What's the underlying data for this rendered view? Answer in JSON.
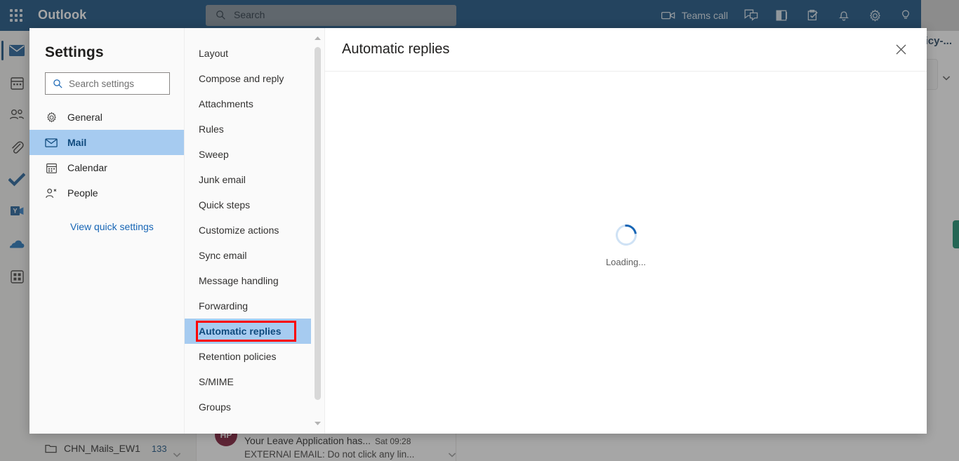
{
  "topbar": {
    "brand": "Outlook",
    "waffle_icon": "app-launcher-icon",
    "search": {
      "placeholder": "Search",
      "icon": "search-icon"
    },
    "teams_call_label": "Teams call",
    "icons": [
      {
        "name": "video-camera-icon"
      },
      {
        "name": "chat-icon"
      },
      {
        "name": "office-app-icon"
      },
      {
        "name": "tasks-icon"
      },
      {
        "name": "notifications-bell-icon"
      },
      {
        "name": "settings-gear-icon"
      },
      {
        "name": "lightbulb-idea-icon"
      }
    ]
  },
  "rail": {
    "items": [
      {
        "name": "mail-icon",
        "label": "Mail",
        "selected": true
      },
      {
        "name": "calendar-icon",
        "label": "Calendar",
        "selected": false
      },
      {
        "name": "people-icon",
        "label": "People",
        "selected": false
      },
      {
        "name": "attachments-paperclip-icon",
        "label": "Files",
        "selected": false
      },
      {
        "name": "todo-check-icon",
        "label": "To Do",
        "selected": false
      },
      {
        "name": "yammer-icon",
        "label": "Yammer",
        "selected": false
      },
      {
        "name": "onedrive-cloud-icon",
        "label": "OneDrive",
        "selected": false
      },
      {
        "name": "all-apps-grid-icon",
        "label": "All apps",
        "selected": false
      }
    ]
  },
  "background": {
    "folder": {
      "name": "CHN_Mails_EW1",
      "count": "133"
    },
    "mail": {
      "avatar_initials": "HP",
      "subject": "Your Leave Application has...",
      "time": "Sat 09:28",
      "preview": "EXTERNAl EMAIL: Do not click any lin..."
    },
    "reading_subject": "licy-...",
    "green_accent_color": "#11896a"
  },
  "settings": {
    "title": "Settings",
    "search": {
      "placeholder": "Search settings",
      "icon": "search-icon"
    },
    "nav": [
      {
        "label": "General",
        "icon": "gear-icon",
        "active": false
      },
      {
        "label": "Mail",
        "icon": "envelope-icon",
        "active": true
      },
      {
        "label": "Calendar",
        "icon": "calendar-icon",
        "active": false
      },
      {
        "label": "People",
        "icon": "person-icon",
        "active": false
      }
    ],
    "quick_settings_link": "View quick settings",
    "subnav": [
      {
        "label": "Layout",
        "active": false
      },
      {
        "label": "Compose and reply",
        "active": false
      },
      {
        "label": "Attachments",
        "active": false
      },
      {
        "label": "Rules",
        "active": false
      },
      {
        "label": "Sweep",
        "active": false
      },
      {
        "label": "Junk email",
        "active": false
      },
      {
        "label": "Quick steps",
        "active": false
      },
      {
        "label": "Customize actions",
        "active": false
      },
      {
        "label": "Sync email",
        "active": false
      },
      {
        "label": "Message handling",
        "active": false
      },
      {
        "label": "Forwarding",
        "active": false
      },
      {
        "label": "Automatic replies",
        "active": true,
        "annotated": true
      },
      {
        "label": "Retention policies",
        "active": false
      },
      {
        "label": "S/MIME",
        "active": false
      },
      {
        "label": "Groups",
        "active": false
      }
    ],
    "main": {
      "title": "Automatic replies",
      "close_icon": "close-icon",
      "loading_text": "Loading...",
      "spinner_icon": "loading-spinner-icon"
    },
    "annotation_color": "#ff0000",
    "accent_color": "#0f4a7d",
    "selection_color": "#a6cbf0"
  }
}
